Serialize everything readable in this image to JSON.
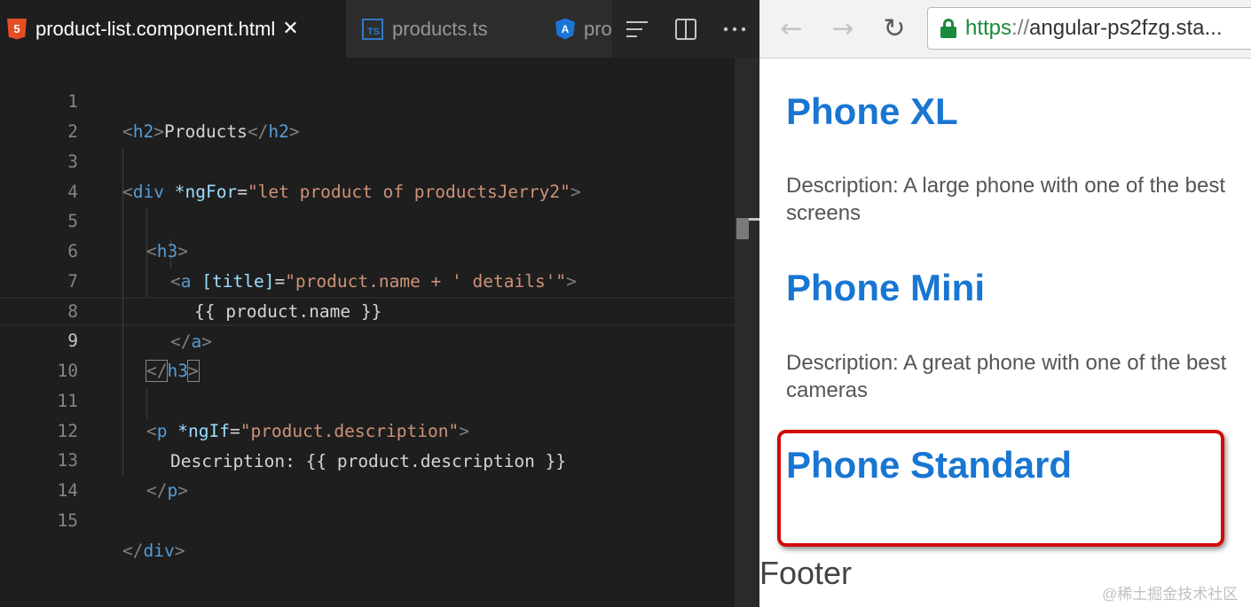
{
  "editor": {
    "tabs": [
      {
        "label": "product-list.component.html",
        "icon": "html5-icon",
        "active": true
      },
      {
        "label": "products.ts",
        "icon": "typescript-icon",
        "active": false
      },
      {
        "label": "pro",
        "icon": "angular-icon",
        "active": false
      }
    ],
    "close_glyph": "✕",
    "actions": [
      "outline-icon",
      "split-editor-icon",
      "more-actions-icon"
    ],
    "line_numbers": [
      "1",
      "2",
      "3",
      "4",
      "5",
      "6",
      "7",
      "8",
      "9",
      "10",
      "11",
      "12",
      "13",
      "14",
      "15"
    ],
    "active_line": "9",
    "code": {
      "l1": {
        "open": "<",
        "tag": "h2",
        "close": ">",
        "text": "Products",
        "end_open": "</",
        "end_tag": "h2",
        "end_close": ">"
      },
      "l3": {
        "open": "<",
        "tag": "div",
        "attr": "*ngFor",
        "eq": "=",
        "value": "\"let product of productsJerry2\"",
        "close": ">"
      },
      "l5": {
        "open": "<",
        "tag": "h3",
        "close": ">"
      },
      "l6": {
        "open": "<",
        "tag": "a",
        "attr": "[title]",
        "eq": "=",
        "value": "\"product.name + ' details'\"",
        "close": ">"
      },
      "l7": {
        "text": "{{ product.name }}"
      },
      "l8": {
        "open": "</",
        "tag": "a",
        "close": ">"
      },
      "l9": {
        "open": "</",
        "tag": "h3",
        "close": ">"
      },
      "l11": {
        "open": "<",
        "tag": "p",
        "attr": "*ngIf",
        "eq": "=",
        "value": "\"product.description\"",
        "close": ">"
      },
      "l12": {
        "text": "Description: {{ product.description }}"
      },
      "l13": {
        "open": "</",
        "tag": "p",
        "close": ">"
      },
      "l15": {
        "open": "</",
        "tag": "div",
        "close": ">"
      }
    }
  },
  "browser": {
    "url": {
      "scheme": "https",
      "sep": "://",
      "host": "angular-ps2fzg.sta..."
    },
    "nav": {
      "back": "←",
      "forward": "→",
      "reload": "↻"
    },
    "products": [
      {
        "name": "Phone XL",
        "description": "Description: A large phone with one of the best screens"
      },
      {
        "name": "Phone Mini",
        "description": "Description: A great phone with one of the best cameras"
      },
      {
        "name": "Phone Standard",
        "description": ""
      }
    ],
    "footer": "Footer",
    "watermark": "@稀土掘金技术社区",
    "highlight_color": "#d10b0b"
  },
  "colors": {
    "editor_bg": "#1e1e1e",
    "tag": "#569cd6",
    "attribute": "#9cdcfe",
    "string": "#ce9178",
    "link": "#1976d2"
  }
}
